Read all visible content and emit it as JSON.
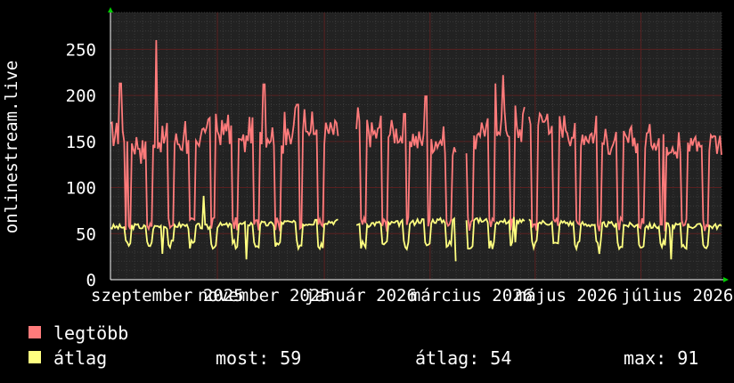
{
  "chart_data": {
    "type": "line",
    "ylabel": "onlinestream.live",
    "ylim": [
      0,
      290
    ],
    "yticks": [
      0,
      50,
      100,
      150,
      200,
      250
    ],
    "grid": true,
    "xlim": [
      0,
      100
    ],
    "x_ticks": [
      {
        "label": "szeptember 2025",
        "x": 0
      },
      {
        "label": "november 2025",
        "x": 17.5
      },
      {
        "label": "január 2026",
        "x": 35
      },
      {
        "label": "március 2026",
        "x": 52.3
      },
      {
        "label": "május 2026",
        "x": 69.5
      },
      {
        "label": "július 2026",
        "x": 86.8
      }
    ],
    "series": [
      {
        "name": "legtöbb",
        "color": "#ff7b7b",
        "base": [
          158,
          148,
          140,
          152,
          150,
          145,
          170,
          160,
          148,
          162,
          158,
          150,
          175,
          168,
          160,
          170,
          165,
          158,
          160,
          155,
          150,
          152,
          148,
          142,
          165,
          170,
          162,
          175,
          172,
          168,
          160,
          158,
          150,
          148,
          152,
          155,
          150,
          145,
          148,
          150
        ],
        "spikes": [
          [
            1.6,
            213
          ],
          [
            2.8,
            150
          ],
          [
            7.5,
            260
          ],
          [
            9.3,
            170
          ],
          [
            12.2,
            172
          ],
          [
            14.8,
            155
          ],
          [
            17.2,
            180
          ],
          [
            19.3,
            179
          ],
          [
            25.1,
            212
          ],
          [
            28.5,
            182
          ],
          [
            30.6,
            190
          ],
          [
            33.4,
            158
          ],
          [
            37.6,
            159
          ],
          [
            40.5,
            187
          ],
          [
            44.2,
            178
          ],
          [
            48.1,
            180
          ],
          [
            51.6,
            199
          ],
          [
            57.4,
            212
          ],
          [
            58.0,
            205
          ],
          [
            63.0,
            213
          ],
          [
            64.2,
            222
          ],
          [
            66.2,
            189
          ],
          [
            71.5,
            180
          ],
          [
            75.9,
            170
          ],
          [
            79.5,
            178
          ],
          [
            86.3,
            148
          ],
          [
            90.6,
            158
          ],
          [
            93.1,
            160
          ],
          [
            95.6,
            152
          ],
          [
            98.7,
            156
          ]
        ],
        "gaps": [
          [
            37.5,
            40.0
          ],
          [
            56.6,
            58.2
          ],
          [
            67.8,
            68.3
          ]
        ]
      },
      {
        "name": "átlag",
        "color": "#ffff80",
        "base": [
          57,
          58,
          57,
          58,
          59,
          58,
          57,
          59,
          60,
          61,
          60,
          62,
          61,
          62,
          63,
          62,
          60,
          61,
          61,
          62,
          64,
          64,
          65,
          66,
          64,
          63,
          64,
          63,
          62,
          62,
          61,
          60,
          60,
          59,
          59,
          58,
          59,
          59,
          58,
          58
        ],
        "spikes": [
          [
            15.2,
            91
          ],
          [
            33.6,
            65
          ],
          [
            57.6,
            73
          ],
          [
            66.0,
            68
          ]
        ],
        "dips": [
          [
            8.6,
            28
          ],
          [
            22.3,
            22
          ],
          [
            38.5,
            32
          ],
          [
            41.5,
            38
          ],
          [
            56.6,
            20
          ],
          [
            80.0,
            28
          ],
          [
            91.8,
            22
          ]
        ],
        "gaps": [
          [
            37.5,
            40.0
          ],
          [
            56.6,
            58.2
          ],
          [
            67.8,
            68.3
          ]
        ]
      }
    ]
  },
  "legend": {
    "max_label": "legtöbb",
    "avg_label": "átlag",
    "now_text": "most: 59",
    "avg_text": "átlag: 54",
    "peak_text": "max: 91"
  }
}
